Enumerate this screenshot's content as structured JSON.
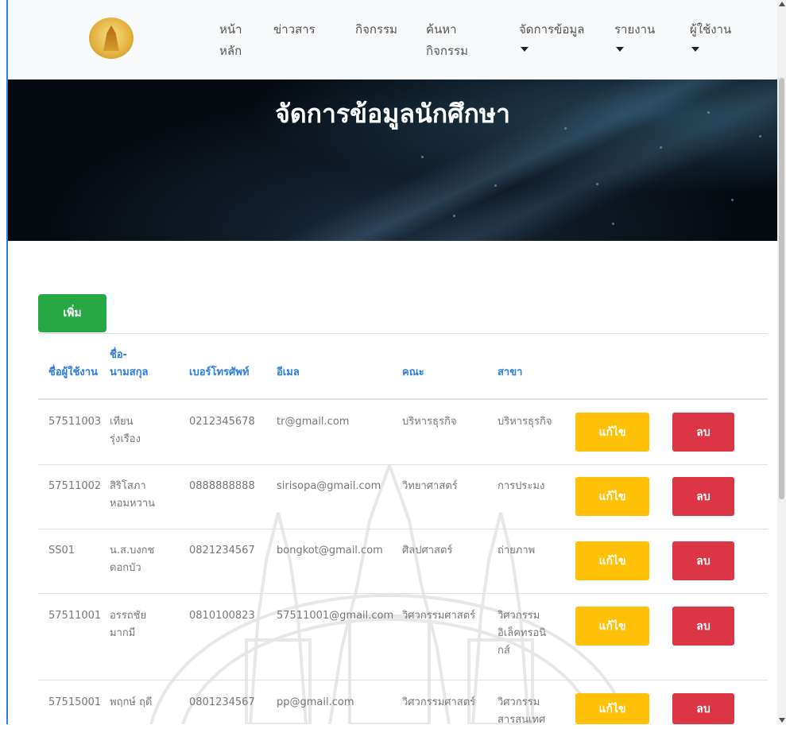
{
  "nav": {
    "items": [
      {
        "label_line1": "หน้า",
        "label_line2": "หลัก",
        "has_caret": false
      },
      {
        "label_line1": "ข่าวสาร",
        "label_line2": "",
        "has_caret": false
      },
      {
        "label_line1": "กิจกรรม",
        "label_line2": "",
        "has_caret": false
      },
      {
        "label_line1": "ค้นหา",
        "label_line2": "กิจกรรม",
        "has_caret": false
      },
      {
        "label_line1": "จัดการข้อมูล",
        "label_line2": "",
        "has_caret": true
      },
      {
        "label_line1": "รายงาน",
        "label_line2": "",
        "has_caret": true
      },
      {
        "label_line1": "ผู้ใช้งาน",
        "label_line2": "",
        "has_caret": true
      }
    ]
  },
  "hero": {
    "title": "จัดการข้อมูลนักศึกษา"
  },
  "add_button": "เพิ่ม",
  "table": {
    "headers": {
      "username": "ชื่อผู้ใช้งาน",
      "name_line1": "ชื่อ-",
      "name_line2": "นามสกุล",
      "phone": "เบอร์โทรศัพท์",
      "email": "อีเมล",
      "faculty": "คณะ",
      "major": "สาขา"
    },
    "rows": [
      {
        "username": "57511003",
        "name_line1": "เทียน",
        "name_line2": "รุ่งเรือง",
        "phone": "0212345678",
        "email": "tr@gmail.com",
        "faculty": "บริหารธุรกิจ",
        "major_line1": "บริหารธุรกิจ",
        "major_line2": "",
        "major_line3": "",
        "edit": "แก้ไข",
        "delete": "ลบ"
      },
      {
        "username": "57511002",
        "name_line1": "สิริโสภา",
        "name_line2": "หอมหวาน",
        "phone": "0888888888",
        "email": "sirisopa@gmail.com",
        "faculty": "วิทยาศาสตร์",
        "major_line1": "การประมง",
        "major_line2": "",
        "major_line3": "",
        "edit": "แก้ไข",
        "delete": "ลบ"
      },
      {
        "username": "SS01",
        "name_line1": "น.ส.บงกช",
        "name_line2": "ดอกบัว",
        "phone": "0821234567",
        "email": "bongkot@gmail.com",
        "faculty": "ศิลปศาสตร์",
        "major_line1": "ถ่ายภาพ",
        "major_line2": "",
        "major_line3": "",
        "edit": "แก้ไข",
        "delete": "ลบ"
      },
      {
        "username": "57511001",
        "name_line1": "อรรถชัย",
        "name_line2": "มากมี",
        "phone": "0810100823",
        "email": "57511001@gmail.com",
        "faculty": "วิศวกรรมศาสตร์",
        "major_line1": "วิศวกรรม",
        "major_line2": "อิเล็คทรอนิ",
        "major_line3": "กส์",
        "edit": "แก้ไข",
        "delete": "ลบ"
      },
      {
        "username": "57515001",
        "name_line1": "พฤกษ์ ฤดี",
        "name_line2": "",
        "phone": "0801234567",
        "email": "pp@gmail.com",
        "faculty": "วิศวกรรมศาสตร์",
        "major_line1": "วิศวกรรม",
        "major_line2": "สารสนเทศ",
        "major_line3": "",
        "edit": "แก้ไข",
        "delete": "ลบ"
      }
    ]
  },
  "colors": {
    "primary": "#2a7de1",
    "success": "#28a745",
    "warning": "#ffc107",
    "danger": "#dc3545"
  },
  "icons": [
    "university-seal-icon",
    "caret-down-icon"
  ]
}
